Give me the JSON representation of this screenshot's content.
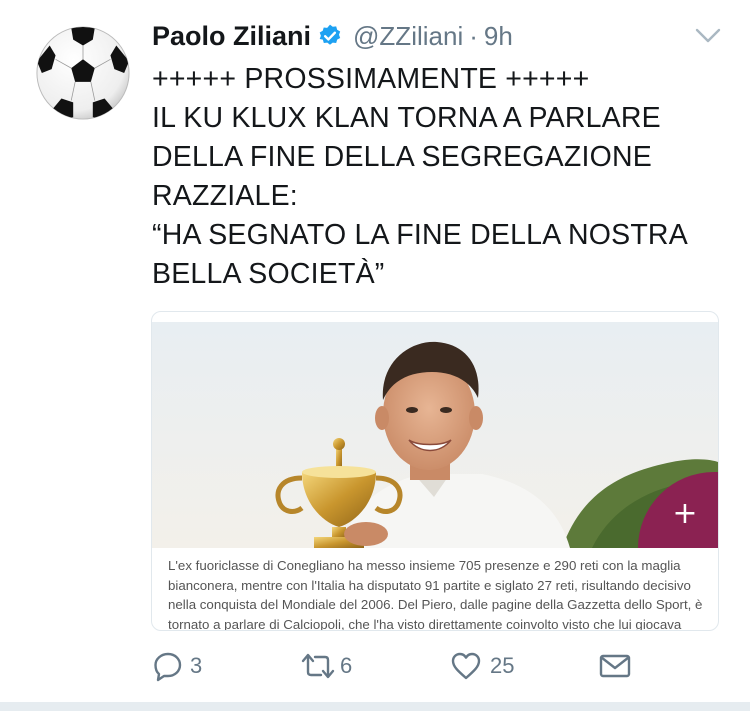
{
  "tweet": {
    "author_name": "Paolo Ziliani",
    "handle": "@ZZiliani",
    "separator": "·",
    "time": "9h",
    "text_lines": [
      "+++++ PROSSIMAMENTE +++++",
      "IL KU KLUX KLAN TORNA A PARLARE",
      "DELLA FINE DELLA SEGREGAZIONE",
      "RAZZIALE:",
      "“HA SEGNATO LA FINE DELLA NOSTRA",
      "BELLA SOCIETÀ”"
    ]
  },
  "card": {
    "caption": "L'ex fuoriclasse di Conegliano ha messo insieme 705 presenze e 290 reti con la maglia bianconera, mentre con l'Italia ha disputato 91 partite e siglato 27 reti, risultando decisivo nella conquista del Mondiale del 2006. Del Piero, dalle pagine della Gazzetta dello Sport, è tornato a parlare di Calciopoli, che l'ha visto direttamente coinvolto visto che lui giocava",
    "expand_label": "+"
  },
  "actions": {
    "reply_count": "3",
    "retweet_count": "6",
    "like_count": "25"
  },
  "icons": {
    "verified": "verified-badge-icon",
    "caret": "chevron-down-icon",
    "reply": "reply-icon",
    "retweet": "retweet-icon",
    "like": "heart-icon",
    "dm": "envelope-icon"
  },
  "colors": {
    "verified": "#1da1f2",
    "muted": "#657786",
    "card_accent": "#8b2252"
  }
}
